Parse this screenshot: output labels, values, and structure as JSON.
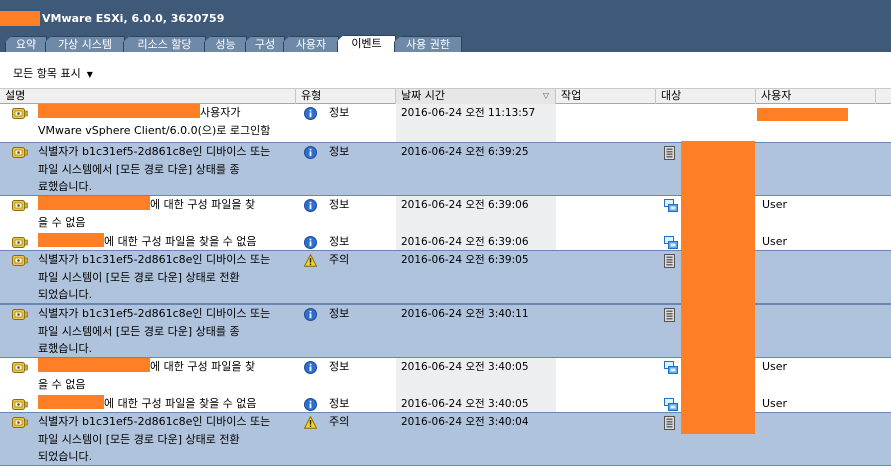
{
  "window": {
    "title": "VMware ESXi, 6.0.0, 3620759"
  },
  "tabs": [
    {
      "label": "요약"
    },
    {
      "label": "가상 시스템"
    },
    {
      "label": "리소스 할당"
    },
    {
      "label": "성능"
    },
    {
      "label": "구성"
    },
    {
      "label": "사용자"
    },
    {
      "label": "이벤트"
    },
    {
      "label": "사용 권한"
    }
  ],
  "toolbar": {
    "filter_label": "모든 항목 표시"
  },
  "columns": {
    "description": "설명",
    "type": "유형",
    "datetime": "날짜 시간",
    "task": "작업",
    "target": "대상",
    "user": "사용자"
  },
  "events": [
    {
      "desc": [
        "사용자가",
        "VMware vSphere Client/6.0.0(으)로 로그인함"
      ],
      "type": "정보",
      "level": "info",
      "date": "2016-06-24 오전 11:13:57",
      "target": "",
      "user": ""
    },
    {
      "desc": [
        "식별자가 b1c31ef5-2d861c8e인 디바이스 또는",
        "파일 시스템에서 [모든 경로 다운] 상태를 종",
        "료했습니다."
      ],
      "type": "정보",
      "level": "info",
      "date": "2016-06-24 오전 6:39:25",
      "target": "host",
      "user": ""
    },
    {
      "desc": [
        "에 대한 구성 파일을 찾",
        "을 수 없음"
      ],
      "type": "정보",
      "level": "info",
      "date": "2016-06-24 오전 6:39:06",
      "target": "vm",
      "user": "User"
    },
    {
      "desc": [
        "에 대한 구성 파일을 찾을 수 없음"
      ],
      "type": "정보",
      "level": "info",
      "date": "2016-06-24 오전 6:39:06",
      "target": "vm",
      "user": "User"
    },
    {
      "desc": [
        "식별자가 b1c31ef5-2d861c8e인 디바이스 또는",
        "파일 시스템이 [모든 경로 다운] 상태로 전환",
        "되었습니다."
      ],
      "type": "주의",
      "level": "warning",
      "date": "2016-06-24 오전 6:39:05",
      "target": "host",
      "user": ""
    },
    {
      "desc": [
        "식별자가 b1c31ef5-2d861c8e인 디바이스 또는",
        "파일 시스템에서 [모든 경로 다운] 상태를 종",
        "료했습니다."
      ],
      "type": "정보",
      "level": "info",
      "date": "2016-06-24 오전 3:40:11",
      "target": "host",
      "user": ""
    },
    {
      "desc": [
        "에 대한 구성 파일을 찾",
        "을 수 없음"
      ],
      "type": "정보",
      "level": "info",
      "date": "2016-06-24 오전 3:40:05",
      "target": "vm",
      "user": "User"
    },
    {
      "desc": [
        "에 대한 구성 파일을 찾을 수 없음"
      ],
      "type": "정보",
      "level": "info",
      "date": "2016-06-24 오전 3:40:05",
      "target": "vm",
      "user": "User"
    },
    {
      "desc": [
        "식별자가 b1c31ef5-2d861c8e인 디바이스 또는",
        "파일 시스템이 [모든 경로 다운] 상태로 전환",
        "되었습니다."
      ],
      "type": "주의",
      "level": "warning",
      "date": "2016-06-24 오전 3:40:04",
      "target": "host",
      "user": ""
    }
  ],
  "colors": {
    "titlebar": "#3f5a78",
    "selection": "#b0c3dd",
    "redaction": "#ff7f27"
  }
}
